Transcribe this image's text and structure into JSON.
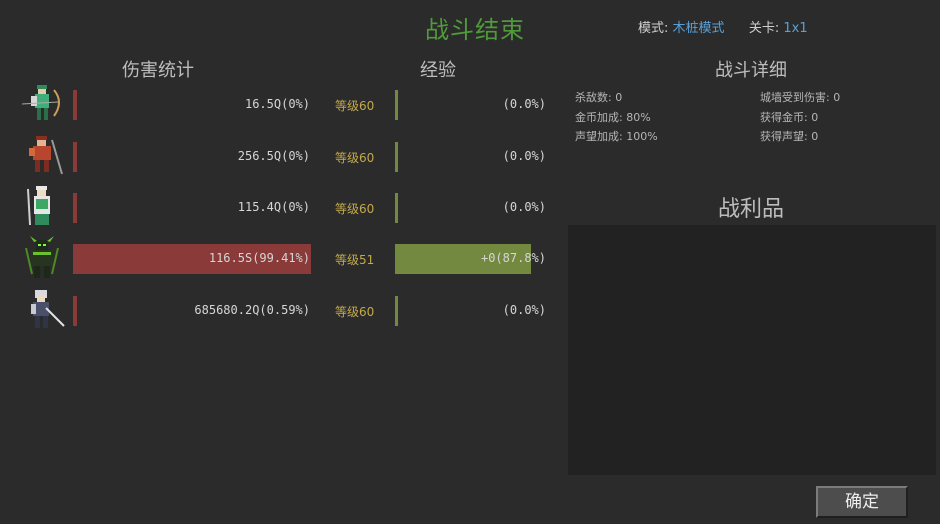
{
  "title": "战斗结束",
  "mode": {
    "mode_label": "模式:",
    "mode_value": "木桩模式",
    "stage_label": "关卡:",
    "stage_value": "1x1"
  },
  "headers": {
    "damage": "伤害统计",
    "exp": "经验",
    "detail": "战斗详细",
    "loot": "战利品"
  },
  "units": [
    {
      "avatar_icon": "archer-hero-icon",
      "damage": "16.5Q(0%)",
      "damage_ratio": 0.0,
      "level": "等级60",
      "exp": "(0.0%)",
      "exp_ratio": 0.0
    },
    {
      "avatar_icon": "warrior-hero-icon",
      "damage": "256.5Q(0%)",
      "damage_ratio": 0.0,
      "level": "等级60",
      "exp": "(0.0%)",
      "exp_ratio": 0.0
    },
    {
      "avatar_icon": "mage-hero-icon",
      "damage": "115.4Q(0%)",
      "damage_ratio": 0.0,
      "level": "等级60",
      "exp": "(0.0%)",
      "exp_ratio": 0.0
    },
    {
      "avatar_icon": "dark-knight-hero-icon",
      "damage": "116.5S(99.41%)",
      "damage_ratio": 0.9941,
      "level": "等级51",
      "exp": "+0(87.8%)",
      "exp_ratio": 0.878
    },
    {
      "avatar_icon": "swordsman-hero-icon",
      "damage": "685680.2Q(0.59%)",
      "damage_ratio": 0.0059,
      "level": "等级60",
      "exp": "(0.0%)",
      "exp_ratio": 0.0
    }
  ],
  "details": {
    "kills": "杀敌数: 0",
    "gold_bonus": "金币加成: 80%",
    "fame_bonus": "声望加成: 100%",
    "wall_damage": "城墙受到伤害: 0",
    "gold_gain": "获得金币: 0",
    "fame_gain": "获得声望: 0"
  },
  "confirm_label": "确定",
  "colors": {
    "damage_bar": "#8a3a38",
    "exp_bar": "#73893f",
    "title": "#4f9a3a",
    "level": "#c4a94a",
    "link": "#5aa0d6"
  }
}
